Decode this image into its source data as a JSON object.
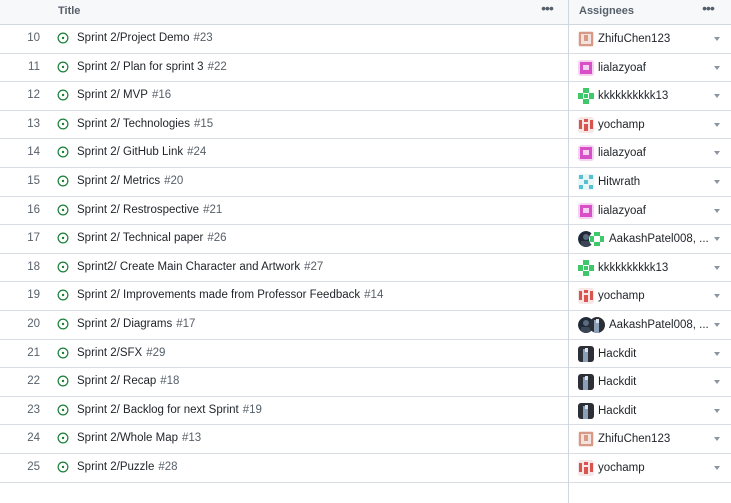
{
  "header": {
    "title_label": "Title",
    "assignees_label": "Assignees",
    "menu_glyph": "•••"
  },
  "rows": [
    {
      "num": "10",
      "title": "Sprint 2/Project Demo",
      "issue": "#23",
      "assignee": "ZhifuChen123",
      "avatar": "zhifu"
    },
    {
      "num": "11",
      "title": "Sprint 2/ Plan for sprint 3",
      "issue": "#22",
      "assignee": "lialazyoaf",
      "avatar": "lialazyoaf"
    },
    {
      "num": "12",
      "title": "Sprint 2/ MVP",
      "issue": "#16",
      "assignee": "kkkkkkkkkk13",
      "avatar": "kkk"
    },
    {
      "num": "13",
      "title": "Sprint 2/ Technologies",
      "issue": "#15",
      "assignee": "yochamp",
      "avatar": "yochamp"
    },
    {
      "num": "14",
      "title": "Sprint 2/ GitHub Link",
      "issue": "#24",
      "assignee": "lialazyoaf",
      "avatar": "lialazyoaf"
    },
    {
      "num": "15",
      "title": "Sprint 2/ Metrics",
      "issue": "#20",
      "assignee": "Hitwrath",
      "avatar": "hitwrath"
    },
    {
      "num": "16",
      "title": "Sprint 2/ Restrospective",
      "issue": "#21",
      "assignee": "lialazyoaf",
      "avatar": "lialazyoaf"
    },
    {
      "num": "17",
      "title": "Sprint 2/ Technical paper",
      "issue": "#26",
      "assignee": "AakashPatel008, ...",
      "avatar": "pair-green"
    },
    {
      "num": "18",
      "title": "Sprint2/ Create Main Character and Artwork",
      "issue": "#27",
      "assignee": "kkkkkkkkkk13",
      "avatar": "kkk"
    },
    {
      "num": "19",
      "title": "Sprint 2/ Improvements made from Professor Feedback",
      "issue": "#14",
      "assignee": "yochamp",
      "avatar": "yochamp"
    },
    {
      "num": "20",
      "title": "Sprint 2/ Diagrams",
      "issue": "#17",
      "assignee": "AakashPatel008, ...",
      "avatar": "pair-dark"
    },
    {
      "num": "21",
      "title": "Sprint 2/SFX",
      "issue": "#29",
      "assignee": "Hackdit",
      "avatar": "hackdit"
    },
    {
      "num": "22",
      "title": "Sprint 2/ Recap",
      "issue": "#18",
      "assignee": "Hackdit",
      "avatar": "hackdit"
    },
    {
      "num": "23",
      "title": "Sprint 2/ Backlog for next Sprint",
      "issue": "#19",
      "assignee": "Hackdit",
      "avatar": "hackdit"
    },
    {
      "num": "24",
      "title": "Sprint 2/Whole Map",
      "issue": "#13",
      "assignee": "ZhifuChen123",
      "avatar": "zhifu"
    },
    {
      "num": "25",
      "title": "Sprint 2/Puzzle",
      "issue": "#28",
      "assignee": "yochamp",
      "avatar": "yochamp"
    }
  ],
  "colors": {
    "status_open": "#1a7f37",
    "border": "#d0d7de"
  },
  "icons": {
    "status": "issue-opened-icon",
    "menu": "kebab-menu-icon",
    "dropdown": "triangle-down-icon"
  }
}
